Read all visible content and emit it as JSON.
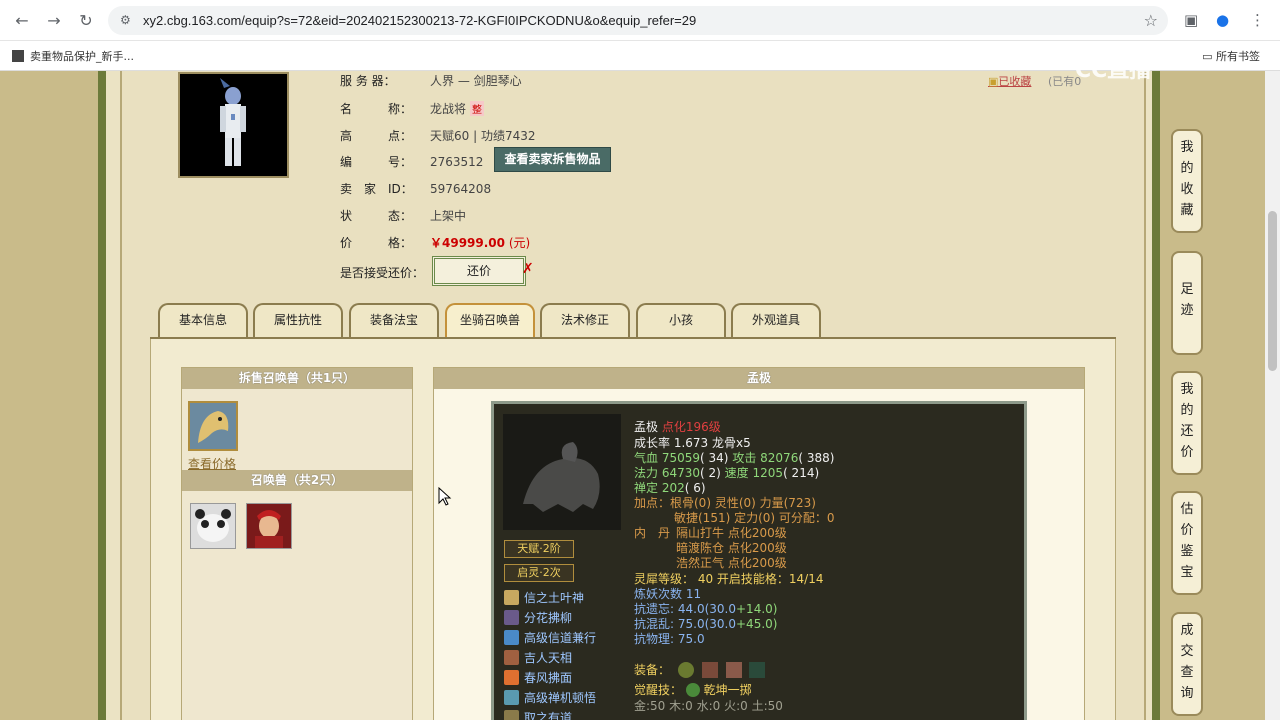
{
  "browser": {
    "url": "xy2.cbg.163.com/equip?s=72&eid=202402152300213-72-KGFI0IPCKODNU&o&equip_refer=29",
    "bookmark": "卖重物品保护_新手...",
    "all_bookmarks": "所有书签"
  },
  "watermark": "CC直播",
  "info": {
    "server_label": "服 务 器：",
    "server_value": "人界 — 剑胆琴心",
    "name_label": "名　　　称：",
    "name_value": "龙战将",
    "name_badge": "整",
    "points_label": "高　　　点：",
    "points_value": "天赋60 | 功绩7432",
    "id_label": "编　　　号：",
    "id_value": "2763512",
    "seller_btn": "查看卖家拆售物品",
    "seller_label": "卖　家　ID：",
    "seller_value": "59764208",
    "status_label": "状　　　态：",
    "status_value": "上架中",
    "price_label": "价　　　格：",
    "price_value": "￥49999.00",
    "price_unit": "(元)",
    "counter_label": "是否接受还价：",
    "counter_btn": "还价",
    "fav_link": "已收藏",
    "fav_count": "(已有0"
  },
  "tabs": [
    "基本信息",
    "属性抗性",
    "装备法宝",
    "坐骑召唤兽",
    "法术修正",
    "小孩",
    "外观道具"
  ],
  "active_tab": "坐骑召唤兽",
  "left_list": {
    "sold_header": "拆售召唤兽（共1只）",
    "check_price": "查看价格",
    "pets_header": "召唤兽（共2只）"
  },
  "detail": {
    "header": "孟极",
    "name": "孟极",
    "refine": "点化196级",
    "growth": "成长率 1.673 龙骨x5",
    "hp_label": "气血",
    "hp": "75059",
    "hp_extra": "( 34)",
    "atk_label": "攻击",
    "atk": "82076",
    "atk_extra": "( 388)",
    "mp_label": "法力",
    "mp": "64730",
    "mp_extra": "( 2)",
    "spd_label": "速度",
    "spd": "1205",
    "spd_extra": "( 214)",
    "zen_label": "禅定",
    "zen": "202",
    "zen_extra": "( 6)",
    "points_line1": "加点：根骨(0) 灵性(0) 力量(723)",
    "points_line2": "敏捷(151) 定力(0) 可分配：0",
    "neidan_label": "内　丹",
    "neidan1": "隔山打牛 点化200级",
    "neidan2": "暗渡陈仓 点化200级",
    "neidan3": "浩然正气 点化200级",
    "lingxi": "灵犀等级： 40 开启技能格：14/14",
    "lianyao": "炼妖次数 11",
    "resist1_label": "抗遗忘:",
    "resist1": "44.0(30.0",
    "resist1_plus": "+14.0)",
    "resist2_label": "抗混乱:",
    "resist2": "75.0(30.0",
    "resist2_plus": "+45.0)",
    "resist3": "抗物理: 75.0",
    "equip_label": "装备：",
    "awake_label": "觉醒技：",
    "awake_value": "乾坤一掷",
    "elements": "金:50 木:0 水:0 火:0 土:50",
    "badge1": "天赋·2阶",
    "badge2": "启灵·2次",
    "skills": [
      "信之土叶神",
      "分花拂柳",
      "高级信道兼行",
      "吉人天相",
      "春风拂面",
      "高级禅机顿悟",
      "取之有道"
    ]
  },
  "sidebar": [
    "我的收藏",
    "足迹",
    "我的还价",
    "估价鉴宝",
    "成交查询"
  ]
}
